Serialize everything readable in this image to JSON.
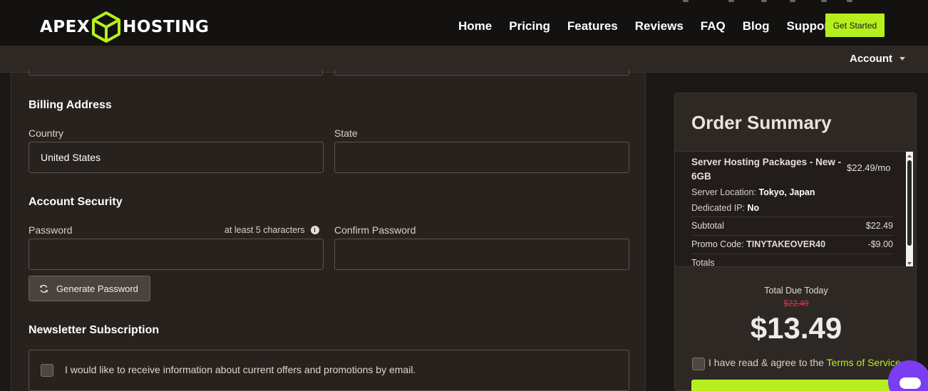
{
  "brand": {
    "logo_left": "APEX",
    "logo_right": "HOSTING",
    "accent_color": "#b6f01c",
    "logo_icon": "cube-icon"
  },
  "nav": {
    "items": [
      {
        "label": "Home"
      },
      {
        "label": "Pricing"
      },
      {
        "label": "Features"
      },
      {
        "label": "Reviews"
      },
      {
        "label": "FAQ"
      },
      {
        "label": "Blog"
      },
      {
        "label": "Support"
      }
    ],
    "cta_label": "Get Started"
  },
  "subbar": {
    "account_label": "Account"
  },
  "billing": {
    "title": "Billing Address",
    "country_label": "Country",
    "country_value": "United States",
    "state_label": "State",
    "state_value": ""
  },
  "security": {
    "title": "Account Security",
    "password_label": "Password",
    "password_hint": "at least 5 characters",
    "confirm_label": "Confirm Password",
    "generate_label": "Generate Password"
  },
  "newsletter": {
    "title": "Newsletter Subscription",
    "checkbox_label": "I would like to receive information about current offers and promotions by email."
  },
  "summary": {
    "title": "Order Summary",
    "item_name": "Server Hosting Packages - New - 6GB",
    "item_price": "$22.49/mo",
    "location_label": "Server Location:",
    "location_value": "Tokyo, Japan",
    "dedicated_ip_label": "Dedicated IP:",
    "dedicated_ip_value": "No",
    "subtotal_label": "Subtotal",
    "subtotal_value": "$22.49",
    "promo_label": "Promo Code:",
    "promo_code": "TINYTAKEOVER40",
    "promo_value": "-$9.00",
    "totals_label": "Totals",
    "total_due_label": "Total Due Today",
    "old_price": "$22.49",
    "total_price": "$13.49",
    "tos_prefix": "I have read & agree to the",
    "tos_link": "Terms of Service"
  }
}
